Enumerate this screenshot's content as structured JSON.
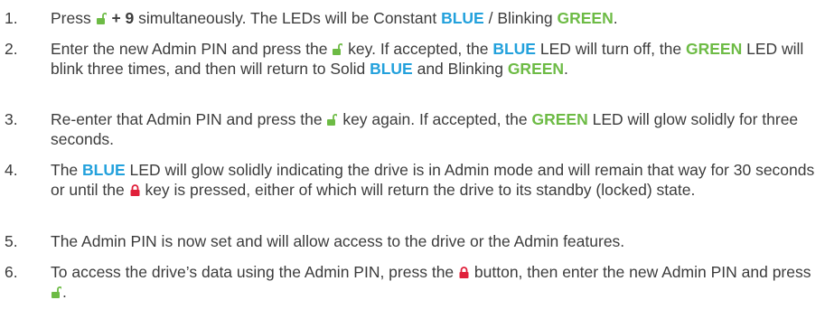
{
  "icons": {
    "unlock": "unlock-icon",
    "lock": "lock-icon",
    "unlock_color": "#6dbb45",
    "lock_color": "#e0203a"
  },
  "colors": {
    "blue": "#23a1dc",
    "green": "#6dbb45",
    "text": "#3c3c3c"
  },
  "steps": [
    {
      "num": "1.",
      "t1": "Press ",
      "t2": " + 9",
      "t3": " simultaneously. The LEDs will be Constant ",
      "blue1": "BLUE",
      "t4": " / Blinking ",
      "green1": "GREEN",
      "t5": "."
    },
    {
      "num": "2.",
      "t1": "Enter the new Admin PIN and press the ",
      "t2": " key. If accepted, the ",
      "blue1": "BLUE",
      "t3": " LED will turn off, the ",
      "green1": "GREEN",
      "t4": " LED will blink three times, and then will return to Solid ",
      "blue2": "BLUE",
      "t5": " and Blinking ",
      "green2": "GREEN",
      "t6": "."
    },
    {
      "num": "3.",
      "t1": "Re-enter that Admin PIN and press the ",
      "t2": " key again. If accepted, the ",
      "green1": "GREEN",
      "t3": " LED will glow solidly for three seconds."
    },
    {
      "num": "4.",
      "t1": "The ",
      "blue1": "BLUE",
      "t2": " LED will glow solidly indicating the drive is in Admin mode and will remain that way for 30 seconds or until the ",
      "t3": " key is pressed, either of which will return the drive to its standby (locked) state."
    },
    {
      "num": "5.",
      "t1": "The Admin PIN is now set and will allow access to the drive or the Admin features."
    },
    {
      "num": "6.",
      "t1": "To access the drive’s data using the Admin PIN, press the ",
      "t2": " button, then enter the new Admin PIN and press ",
      "t3": "."
    }
  ]
}
